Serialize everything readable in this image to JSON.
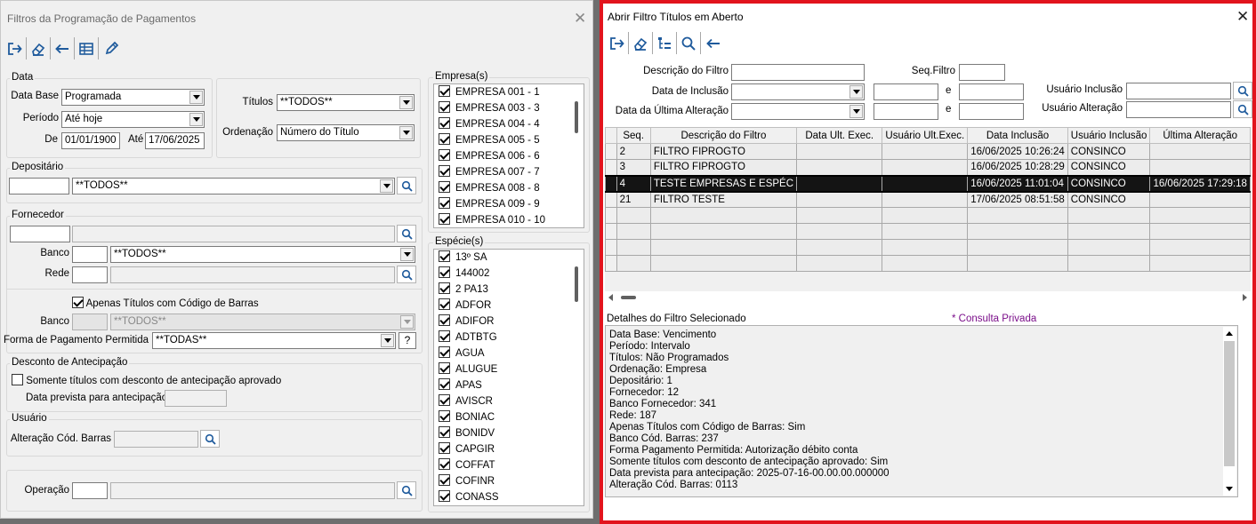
{
  "left": {
    "title": "Filtros da Programação de Pagamentos",
    "toolbar_icons": [
      "exit-icon",
      "eraser-icon",
      "back-arrow-icon",
      "table-icon",
      "pencil-icon"
    ],
    "data": {
      "group": "Data",
      "data_base_label": "Data Base",
      "data_base_value": "Programada",
      "periodo_label": "Período",
      "periodo_value": "Até hoje",
      "de_label": "De",
      "de_value": "01/01/1900",
      "ate_label": "Até",
      "ate_value": "17/06/2025"
    },
    "titulos_label": "Títulos",
    "titulos_value": "**TODOS**",
    "ordenacao_label": "Ordenação",
    "ordenacao_value": "Número do Título",
    "depositario": {
      "group": "Depositário",
      "value": "**TODOS**"
    },
    "fornecedor": {
      "group": "Fornecedor",
      "banco_label": "Banco",
      "banco_value": "**TODOS**",
      "rede_label": "Rede",
      "codigo_barras_label": "Apenas Títulos com Código de Barras",
      "banco2_label": "Banco",
      "banco2_value": "**TODOS**",
      "forma_label": "Forma de Pagamento Permitida",
      "forma_value": "**TODAS**",
      "help": "?"
    },
    "desconto": {
      "group": "Desconto de Antecipação",
      "somente_label": "Somente títulos com desconto de antecipação aprovado",
      "data_prevista_label": "Data prevista para antecipação"
    },
    "usuario": {
      "group": "Usuário",
      "alteracao_label": "Alteração Cód. Barras"
    },
    "operacao_label": "Operação",
    "empresas": {
      "group": "Empresa(s)",
      "items": [
        "EMPRESA 001 - 1",
        "EMPRESA 003 - 3",
        "EMPRESA 004 - 4",
        "EMPRESA 005 - 5",
        "EMPRESA 006 - 6",
        "EMPRESA 007 - 7",
        "EMPRESA 008 - 8",
        "EMPRESA 009 - 9",
        "EMPRESA 010 - 10"
      ]
    },
    "especies": {
      "group": "Espécie(s)",
      "items": [
        "13º SA",
        "144002",
        "2 PA13",
        "ADFOR",
        "ADIFOR",
        "ADTBTG",
        "AGUA",
        "ALUGUE",
        "APAS",
        "AVISCR",
        "BONIAC",
        "BONIDV",
        "CAPGIR",
        "COFFAT",
        "COFINR",
        "CONASS"
      ]
    }
  },
  "right": {
    "title": "Abrir Filtro Títulos em Aberto",
    "toolbar_icons": [
      "exit-icon",
      "eraser-icon",
      "tree-list-icon",
      "search-icon",
      "back-arrow-icon"
    ],
    "descricao_label": "Descrição do Filtro",
    "seq_label": "Seq.Filtro",
    "data_inclusao_label": "Data de Inclusão",
    "e1": "e",
    "usuario_inclusao_label": "Usuário Inclusão",
    "data_alteracao_label": "Data da Última Alteração",
    "e2": "e",
    "usuario_alteracao_label": "Usuário Alteração",
    "columns": [
      "Seq.",
      "Descrição do Filtro",
      "Data Ult. Exec.",
      "Usuário Ult.Exec.",
      "Data Inclusão",
      "Usuário Inclusão",
      "Última Alteração"
    ],
    "rows": [
      [
        "2",
        "FILTRO FIPROGTO",
        "",
        "",
        "16/06/2025 10:26:24",
        "CONSINCO",
        ""
      ],
      [
        "3",
        "FILTRO FIPROGTO",
        "",
        "",
        "16/06/2025 10:28:29",
        "CONSINCO",
        ""
      ],
      [
        "4",
        "TESTE EMPRESAS E ESPÉC",
        "",
        "",
        "16/06/2025 11:01:04",
        "CONSINCO",
        "16/06/2025 17:29:18"
      ],
      [
        "21",
        "FILTRO TESTE",
        "",
        "",
        "17/06/2025 08:51:58",
        "CONSINCO",
        ""
      ]
    ],
    "selected_row": 2,
    "detalhes_label": "Detalhes do Filtro Selecionado",
    "consulta_privada": "* Consulta Privada",
    "details": [
      "Data Base: Vencimento",
      "Período: Intervalo",
      "Títulos: Não Programados",
      "Ordenação: Empresa",
      "Depositário: 1",
      "Fornecedor: 12",
      "Banco Fornecedor: 341",
      "Rede: 187",
      "Apenas Títulos com Código de Barras: Sim",
      "Banco Cód. Barras: 237",
      "Forma Pagamento Permitida: Autorização débito conta",
      "Somente títulos com desconto de antecipação aprovado: Sim",
      "Data prevista para antecipação: 2025-07-16-00.00.00.000000",
      "Alteração Cód. Barras: 0113"
    ]
  },
  "colors": {
    "highlight_border": "#e2141d",
    "selected_row": "#141414",
    "private_text": "#7b0f8a"
  }
}
